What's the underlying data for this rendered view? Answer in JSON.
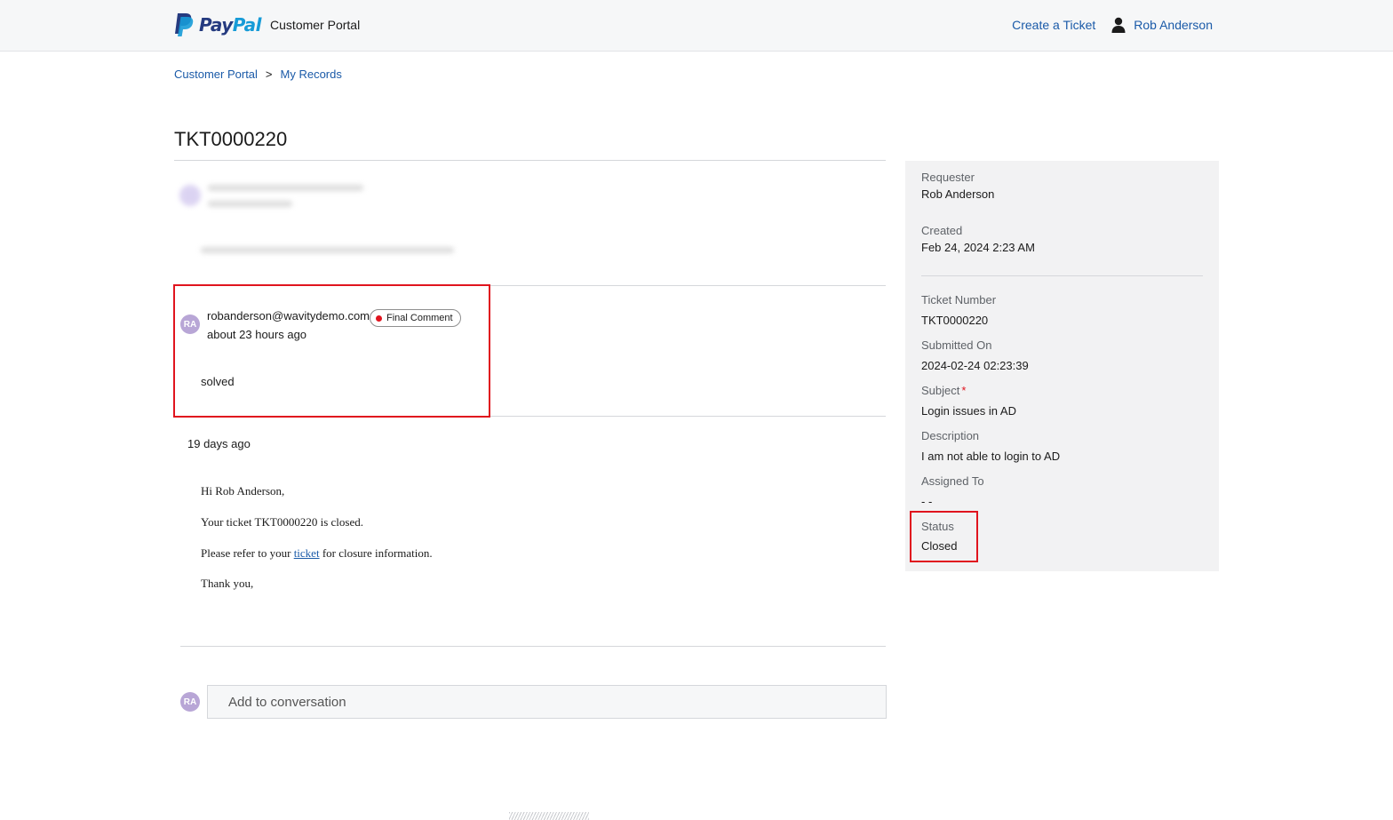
{
  "header": {
    "brand_pay": "Pay",
    "brand_pal": "Pal",
    "portal_name": "Customer Portal",
    "create_ticket": "Create a Ticket",
    "user_name": "Rob Anderson"
  },
  "breadcrumb": {
    "items": [
      "Customer Portal",
      "My Records"
    ],
    "separator": ">"
  },
  "ticket": {
    "title": "TKT0000220"
  },
  "comment": {
    "avatar_initials": "RA",
    "author": "robanderson@wavitydemo.com",
    "badge": "Final Comment",
    "time": "about 23 hours ago",
    "body": "solved"
  },
  "email": {
    "time": "19 days ago",
    "greeting": "Hi Rob Anderson,",
    "line1": "Your ticket TKT0000220 is closed.",
    "line2_prefix": "Please refer to your",
    "line2_link": "ticket",
    "line2_suffix": "for closure information.",
    "signoff": "Thank you,"
  },
  "composer": {
    "avatar_initials": "RA",
    "placeholder": "Add to conversation"
  },
  "details": {
    "requester_label": "Requester",
    "requester_value": "Rob Anderson",
    "created_label": "Created",
    "created_value": "Feb 24, 2024 2:23 AM",
    "ticket_number_label": "Ticket Number",
    "ticket_number_value": "TKT0000220",
    "submitted_on_label": "Submitted On",
    "submitted_on_value": "2024-02-24 02:23:39",
    "subject_label": "Subject",
    "subject_required": "*",
    "subject_value": "Login issues in AD",
    "description_label": "Description",
    "description_value": "I am not able to login to AD",
    "assigned_to_label": "Assigned To",
    "assigned_to_value": "- -",
    "status_label": "Status",
    "status_value": "Closed"
  },
  "colors": {
    "link": "#1a5aa8",
    "highlight": "#e0141e",
    "paypal_dark": "#253b80",
    "paypal_light": "#179bd7"
  }
}
